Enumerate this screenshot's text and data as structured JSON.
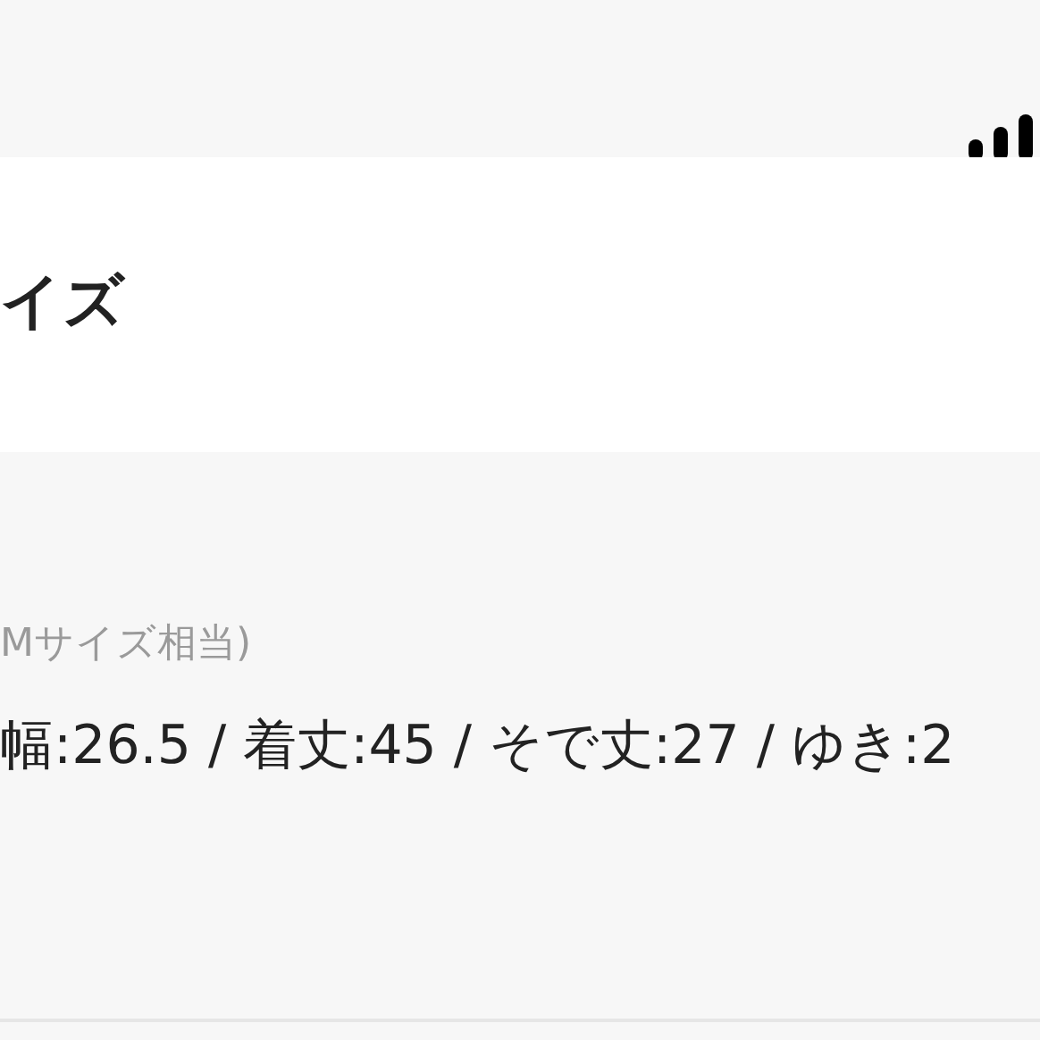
{
  "header": {
    "title": "イズ"
  },
  "details": {
    "note": "Mサイズ相当)",
    "measurements": "幅:26.5 / 着丈:45 / そで丈:27 / ゆき:2"
  }
}
